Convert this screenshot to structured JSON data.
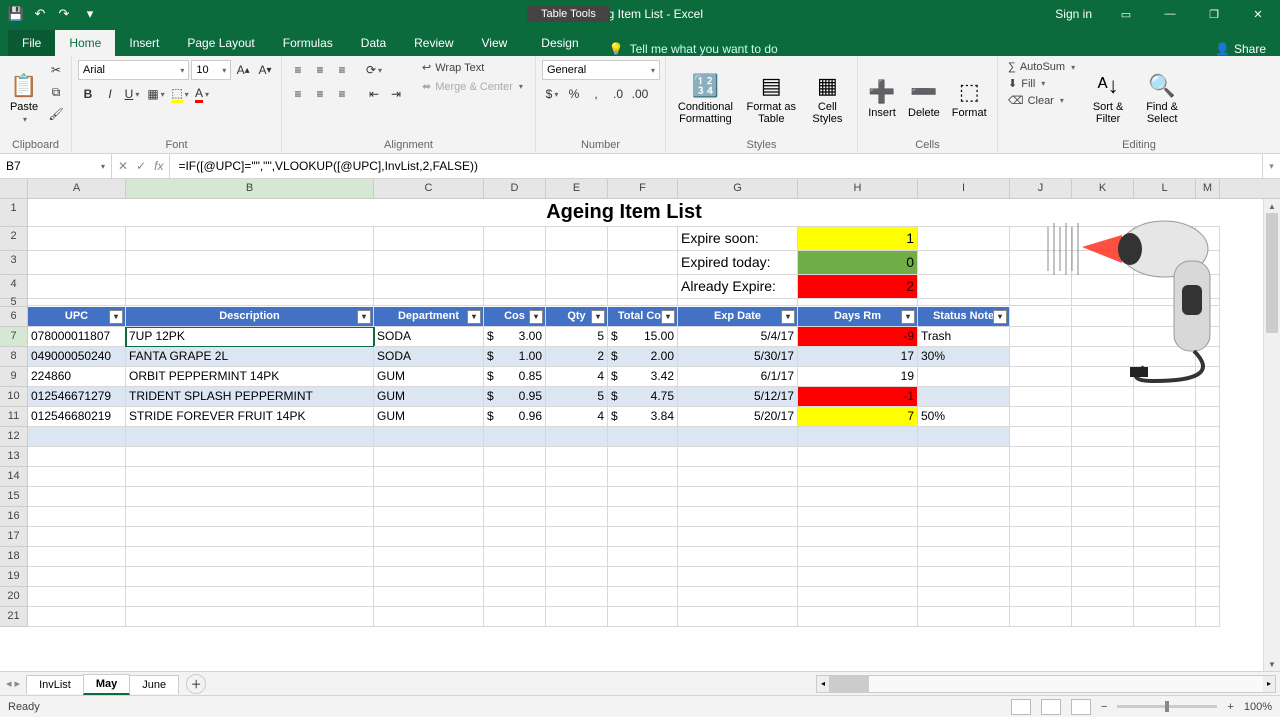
{
  "titlebar": {
    "title": "Ageing Item List  -  Excel",
    "table_tools": "Table Tools",
    "signin": "Sign in"
  },
  "tabs": {
    "file": "File",
    "home": "Home",
    "insert": "Insert",
    "page_layout": "Page Layout",
    "formulas": "Formulas",
    "data": "Data",
    "review": "Review",
    "view": "View",
    "design": "Design",
    "tell": "Tell me what you want to do",
    "share": "Share"
  },
  "ribbon": {
    "clipboard": {
      "label": "Clipboard",
      "paste": "Paste"
    },
    "font": {
      "label": "Font",
      "name": "Arial",
      "size": "10"
    },
    "alignment": {
      "label": "Alignment",
      "wrap": "Wrap Text",
      "merge": "Merge & Center"
    },
    "number": {
      "label": "Number",
      "format": "General"
    },
    "styles": {
      "label": "Styles",
      "cond": "Conditional Formatting",
      "table": "Format as Table",
      "cell": "Cell Styles"
    },
    "cells": {
      "label": "Cells",
      "insert": "Insert",
      "delete": "Delete",
      "format": "Format"
    },
    "editing": {
      "label": "Editing",
      "autosum": "AutoSum",
      "fill": "Fill",
      "clear": "Clear",
      "sort": "Sort & Filter",
      "find": "Find & Select"
    }
  },
  "formula_bar": {
    "ref": "B7",
    "formula": "=IF([@UPC]=\"\",\"\",VLOOKUP([@UPC],InvList,2,FALSE))"
  },
  "cols": {
    "A": "A",
    "B": "B",
    "C": "C",
    "D": "D",
    "E": "E",
    "F": "F",
    "G": "G",
    "H": "H",
    "I": "I",
    "J": "J",
    "K": "K",
    "L": "L",
    "M": "M"
  },
  "colw": {
    "A": 98,
    "B": 248,
    "C": 110,
    "D": 62,
    "E": 62,
    "F": 70,
    "G": 120,
    "H": 120,
    "I": 92,
    "J": 62,
    "K": 62,
    "L": 62,
    "M": 24
  },
  "sheet": {
    "title": "Ageing Item List",
    "sum": {
      "soon_lbl": "Expire soon:",
      "soon_val": "1",
      "today_lbl": "Expired today:",
      "today_val": "0",
      "already_lbl": "Already Expire:",
      "already_val": "2"
    },
    "headers": {
      "upc": "UPC",
      "desc": "Description",
      "dept": "Department",
      "cost": "Cos",
      "qty": "Qty",
      "total": "Total Cos",
      "exp": "Exp Date",
      "days": "Days Rm",
      "status": "Status Note"
    },
    "rows": [
      {
        "upc": "078000011807",
        "desc": "7UP 12PK",
        "dept": "SODA",
        "cost": "3.00",
        "qty": "5",
        "total": "15.00",
        "exp": "5/4/17",
        "days": "-9",
        "status": "Trash",
        "days_cls": "hilite-red"
      },
      {
        "upc": "049000050240",
        "desc": "FANTA GRAPE 2L",
        "dept": "SODA",
        "cost": "1.00",
        "qty": "2",
        "total": "2.00",
        "exp": "5/30/17",
        "days": "17",
        "status": "30%",
        "days_cls": ""
      },
      {
        "upc": "224860",
        "desc": "ORBIT PEPPERMINT 14PK",
        "dept": "GUM",
        "cost": "0.85",
        "qty": "4",
        "total": "3.42",
        "exp": "6/1/17",
        "days": "19",
        "status": "",
        "days_cls": ""
      },
      {
        "upc": "012546671279",
        "desc": "TRIDENT SPLASH PEPPERMINT",
        "dept": "GUM",
        "cost": "0.95",
        "qty": "5",
        "total": "4.75",
        "exp": "5/12/17",
        "days": "-1",
        "status": "",
        "days_cls": "hilite-red"
      },
      {
        "upc": "012546680219",
        "desc": "STRIDE FOREVER FRUIT 14PK",
        "dept": "GUM",
        "cost": "0.96",
        "qty": "4",
        "total": "3.84",
        "exp": "5/20/17",
        "days": "7",
        "status": "50%",
        "days_cls": "hilite-yellow"
      }
    ]
  },
  "sheets": {
    "s1": "InvList",
    "s2": "May",
    "s3": "June"
  },
  "status": {
    "ready": "Ready",
    "zoom": "100%"
  }
}
